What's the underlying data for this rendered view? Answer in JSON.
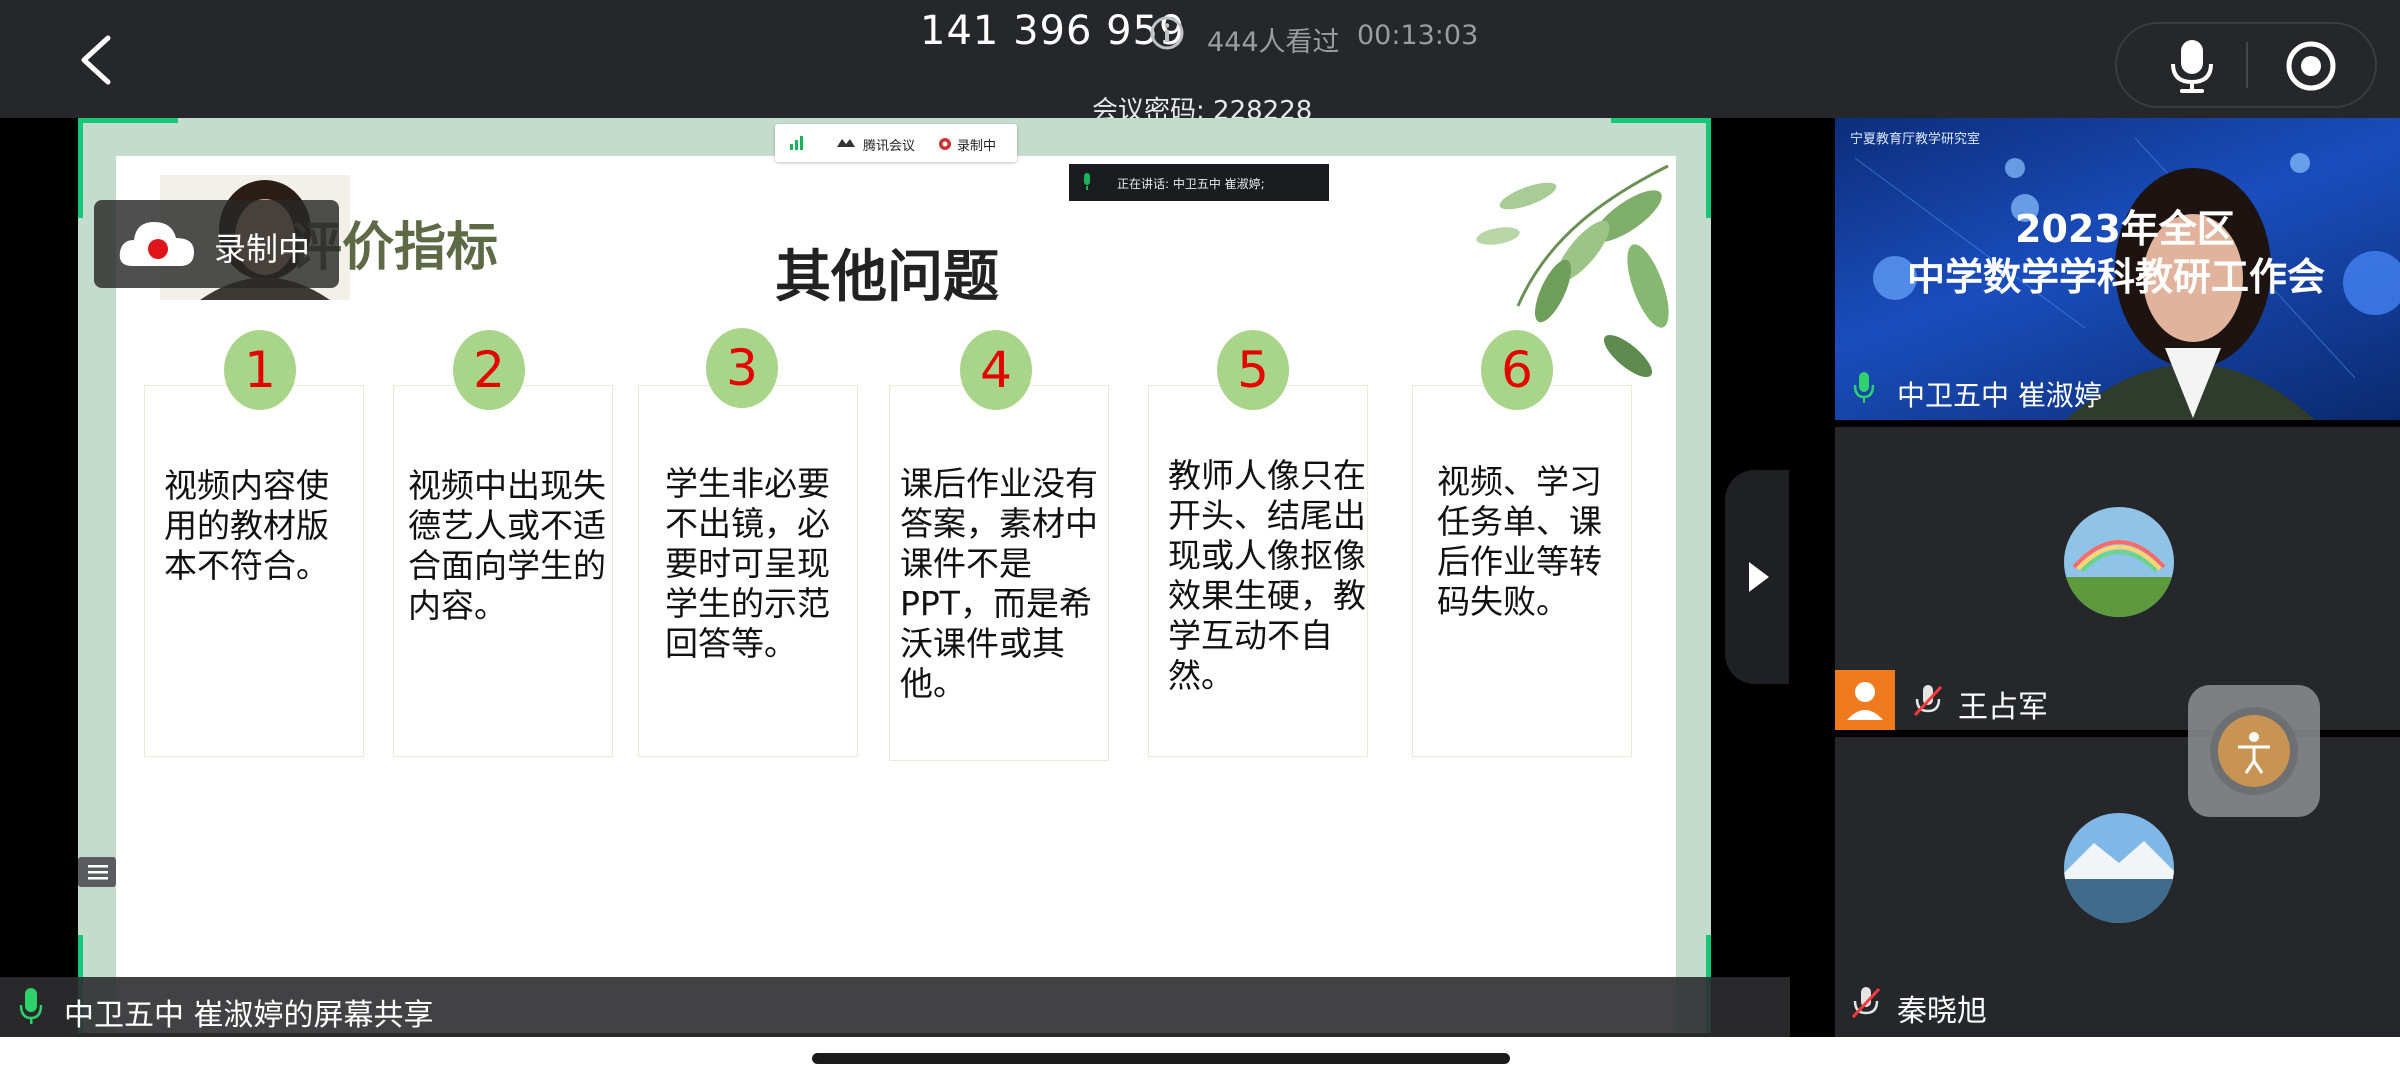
{
  "topbar": {
    "meeting_id": "141 396 959",
    "viewers": "444人看过",
    "timer": "00:13:03",
    "password": "会议密码: 228228"
  },
  "icons": {
    "back": "chevron-left-icon",
    "info": "info-icon",
    "mic": "microphone-icon",
    "record": "record-icon",
    "expand": "triangle-right-icon",
    "accessibility": "accessibility-icon"
  },
  "share": {
    "tencent_logo": "腾讯会议",
    "tencent_recording": "录制中",
    "speaking": "正在讲话: 中卫五中 崔淑婷;",
    "rec_badge": "录制中",
    "slide_subtitle": "评价指标",
    "slide_title": "其他问题",
    "cards": [
      {
        "num": "1",
        "text": "视频内容使用的教材版本不符合。"
      },
      {
        "num": "2",
        "text": "视频中出现失德艺人或不适合面向学生的内容。"
      },
      {
        "num": "3",
        "text": "学生非必要不出镜，必要时可呈现学生的示范回答等。"
      },
      {
        "num": "4",
        "text": "课后作业没有答案，素材中课件不是PPT，而是希沃课件或其他。"
      },
      {
        "num": "5",
        "text": "教师人像只在开头、结尾出现或人像抠像效果生硬，教学互动不自然。"
      },
      {
        "num": "6",
        "text": "视频、学习任务单、课后作业等转码失败。"
      }
    ],
    "footer": "中卫五中 崔淑婷的屏幕共享"
  },
  "participants": {
    "tile1": {
      "banner_top": "宁夏教育厅教学研究室",
      "banner_line1": "2023年全区",
      "banner_line2": "中学数学学科教研工作会",
      "name": "中卫五中 崔淑婷"
    },
    "tile2": {
      "name": "王占军"
    },
    "tile3": {
      "name": "秦晓旭"
    }
  },
  "colors": {
    "topbar": "#25272b",
    "accent_green": "#14c878",
    "number_circle": "#a9d58a",
    "number_text": "#e50000"
  }
}
